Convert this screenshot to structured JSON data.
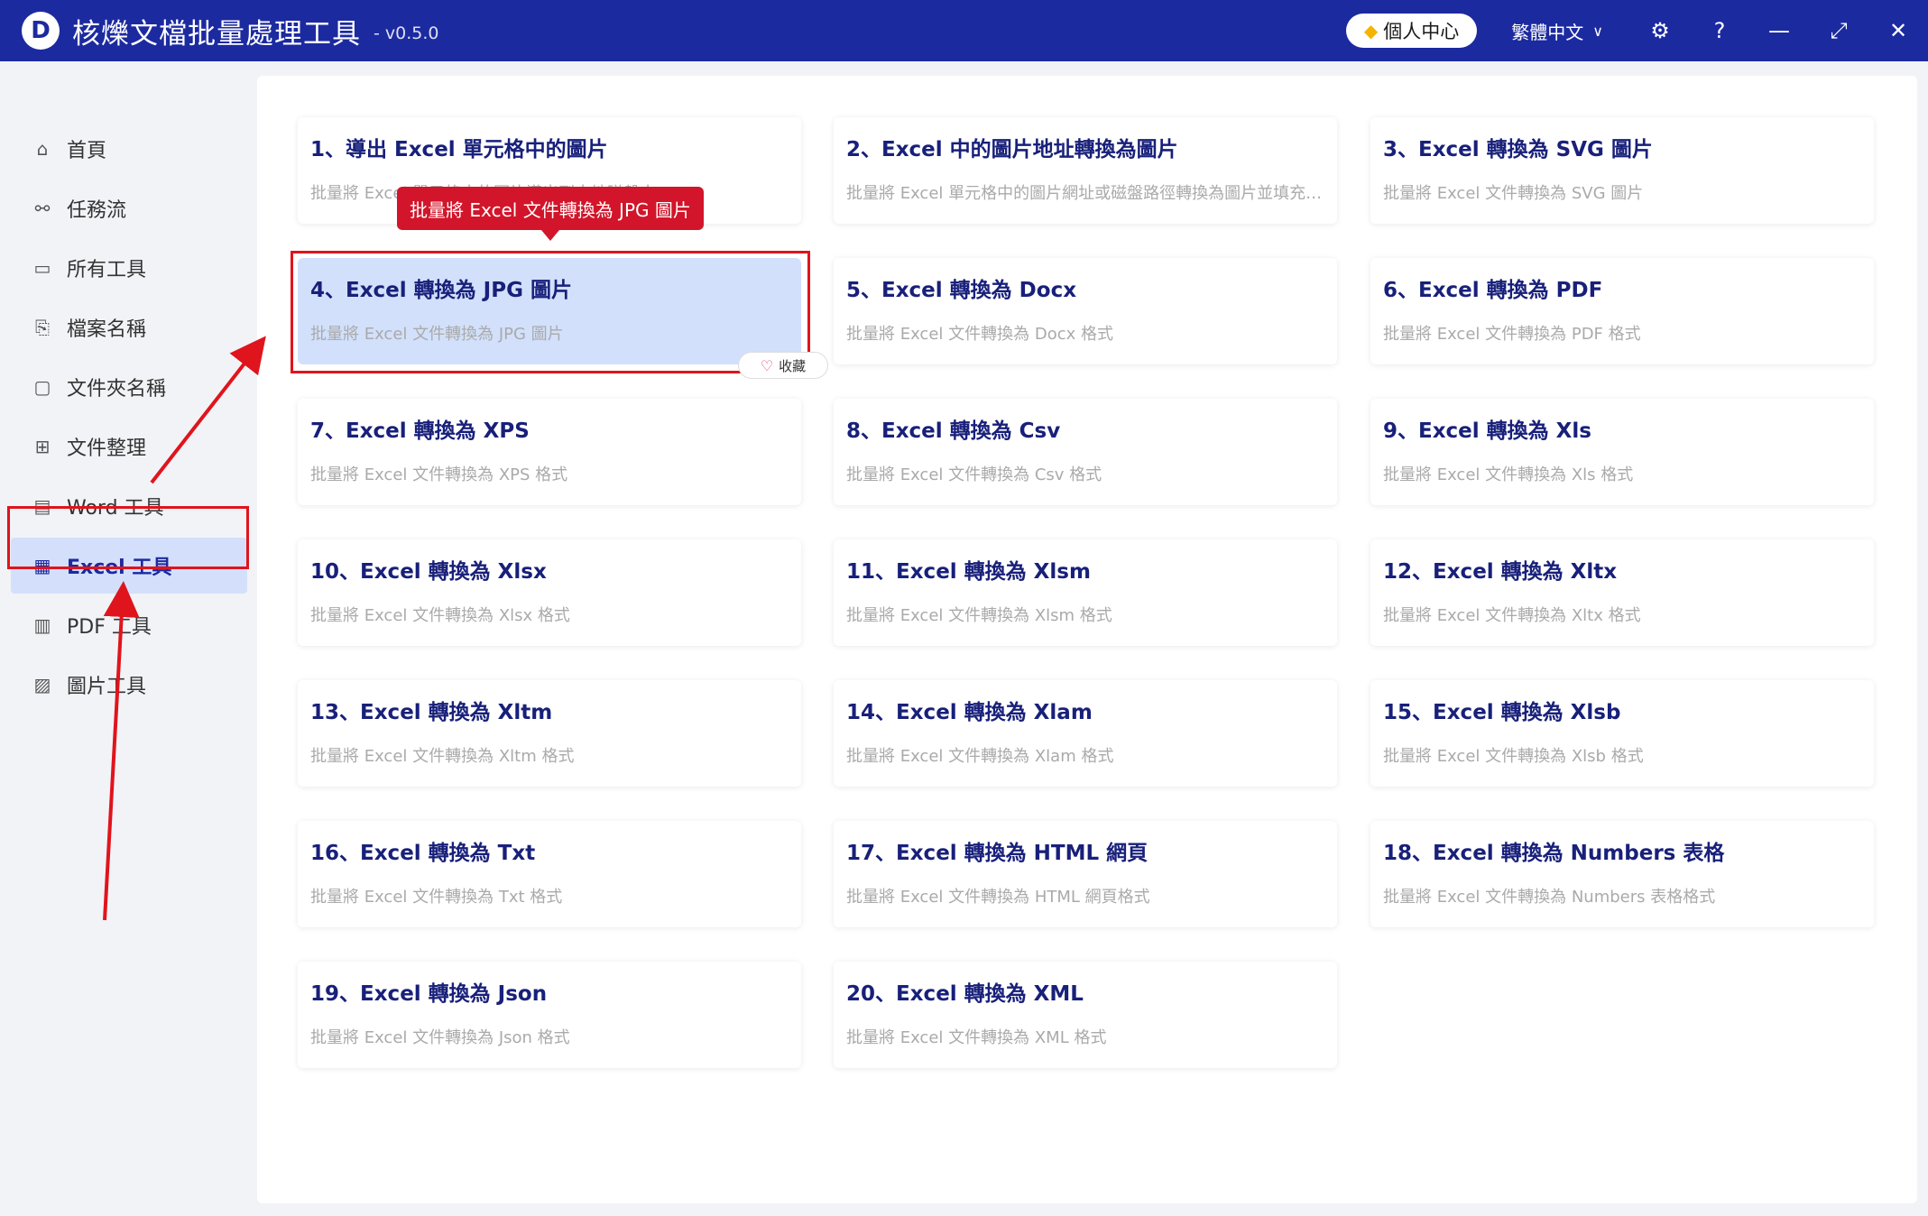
{
  "app": {
    "logo_letter": "D",
    "title": "核爍文檔批量處理工具",
    "version": "- v0.5.0"
  },
  "titlebar": {
    "personal_center": "個人中心",
    "language": "繁體中文"
  },
  "sidebar": {
    "items": [
      {
        "label": "首頁",
        "icon": "home-icon"
      },
      {
        "label": "任務流",
        "icon": "workflow-icon"
      },
      {
        "label": "所有工具",
        "icon": "monitor-icon"
      },
      {
        "label": "檔案名稱",
        "icon": "file-copy-icon"
      },
      {
        "label": "文件夾名稱",
        "icon": "folder-icon"
      },
      {
        "label": "文件整理",
        "icon": "organize-icon"
      },
      {
        "label": "Word 工具",
        "icon": "word-file-icon"
      },
      {
        "label": "Excel 工具",
        "icon": "excel-file-icon",
        "active": true
      },
      {
        "label": "PDF 工具",
        "icon": "pdf-file-icon"
      },
      {
        "label": "圖片工具",
        "icon": "image-icon"
      }
    ]
  },
  "tooltip": "批量將 Excel 文件轉換為 JPG 圖片",
  "favorite_label": "收藏",
  "tools": [
    {
      "title": "1、導出 Excel 單元格中的圖片",
      "desc": "批量將 Excel 單元格中的圖片導出到本地磁盤中"
    },
    {
      "title": "2、Excel 中的圖片地址轉換為圖片",
      "desc": "批量將 Excel 單元格中的圖片網址或磁盤路徑轉換為圖片並填充到..."
    },
    {
      "title": "3、Excel 轉換為 SVG 圖片",
      "desc": "批量將 Excel 文件轉換為 SVG 圖片"
    },
    {
      "title": "4、Excel 轉換為 JPG 圖片",
      "desc": "批量將 Excel 文件轉換為 JPG 圖片",
      "selected": true
    },
    {
      "title": "5、Excel 轉換為 Docx",
      "desc": "批量將 Excel 文件轉換為 Docx 格式"
    },
    {
      "title": "6、Excel 轉換為 PDF",
      "desc": "批量將 Excel 文件轉換為 PDF 格式"
    },
    {
      "title": "7、Excel 轉換為 XPS",
      "desc": "批量將 Excel 文件轉換為 XPS 格式"
    },
    {
      "title": "8、Excel 轉換為 Csv",
      "desc": "批量將 Excel 文件轉換為 Csv 格式"
    },
    {
      "title": "9、Excel 轉換為 Xls",
      "desc": "批量將 Excel 文件轉換為 Xls 格式"
    },
    {
      "title": "10、Excel 轉換為 Xlsx",
      "desc": "批量將 Excel 文件轉換為 Xlsx 格式"
    },
    {
      "title": "11、Excel 轉換為 Xlsm",
      "desc": "批量將 Excel 文件轉換為 Xlsm 格式"
    },
    {
      "title": "12、Excel 轉換為 Xltx",
      "desc": "批量將 Excel 文件轉換為 Xltx 格式"
    },
    {
      "title": "13、Excel 轉換為 Xltm",
      "desc": "批量將 Excel 文件轉換為 Xltm 格式"
    },
    {
      "title": "14、Excel 轉換為 Xlam",
      "desc": "批量將 Excel 文件轉換為 Xlam 格式"
    },
    {
      "title": "15、Excel 轉換為 Xlsb",
      "desc": "批量將 Excel 文件轉換為 Xlsb 格式"
    },
    {
      "title": "16、Excel 轉換為 Txt",
      "desc": "批量將 Excel 文件轉換為 Txt 格式"
    },
    {
      "title": "17、Excel 轉換為 HTML 網頁",
      "desc": "批量將 Excel 文件轉換為 HTML 網頁格式"
    },
    {
      "title": "18、Excel 轉換為 Numbers 表格",
      "desc": "批量將 Excel 文件轉換為 Numbers 表格格式"
    },
    {
      "title": "19、Excel 轉換為 Json",
      "desc": "批量將 Excel 文件轉換為 Json 格式"
    },
    {
      "title": "20、Excel 轉換為 XML",
      "desc": "批量將 Excel 文件轉換為 XML 格式"
    }
  ],
  "colors": {
    "titlebar": "#1c2aa0",
    "accent": "#1c2aa0",
    "highlight": "#e0141c",
    "selected_card": "#d2e0fb"
  }
}
